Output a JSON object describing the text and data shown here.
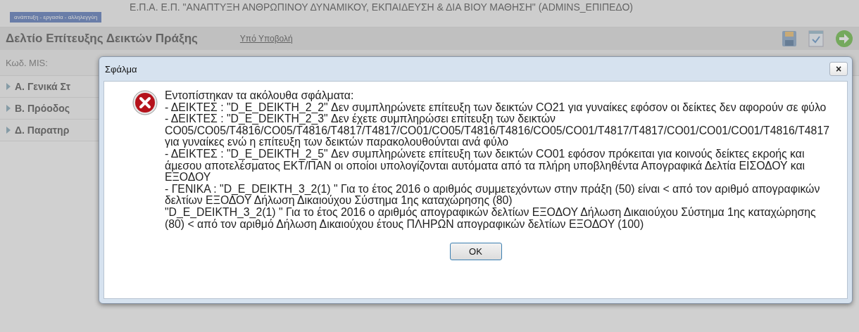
{
  "header": {
    "tagline": "ανάπτυξη - εργασία - αλληλεγγύη",
    "program_title": "Ε.Π.Α. Ε.Π. \"ΑΝΑΠΤΥΞΗ ΑΝΘΡΩΠΙΝΟΥ ΔΥΝΑΜΙΚΟΥ, ΕΚΠΑΙΔΕΥΣΗ & ΔΙΑ ΒΙΟΥ ΜΑΘΗΣΗ\" (ADMINS_ΕΠΙΠΕΔΟ)"
  },
  "page": {
    "title": "Δελτίο Επίτευξης Δεικτών Πράξης",
    "status_link": "Υπό Υποβολή",
    "mis_label": "Κωδ. MIS:",
    "sections": [
      {
        "label": "Α. Γενικά Στ",
        "expanded": false
      },
      {
        "label": "Β. Πρόοδος",
        "expanded": false
      },
      {
        "label": "Δ. Παρατηρ",
        "expanded": false
      }
    ]
  },
  "dialog": {
    "title": "Σφάλμα",
    "close_glyph": "×",
    "kind": "error",
    "message_lines": [
      "Εντοπίστηκαν τα ακόλουθα σφάλματα:",
      "- ΔΕΙΚΤΕΣ : \"D_E_DEIKTH_2_2\" Δεν συμπληρώνετε επίτευξη των δεικτών CO21 για γυναίκες εφόσον οι δείκτες δεν αφορούν σε φύλο",
      "- ΔΕΙΚΤΕΣ : \"D_E_DEIKTH_2_3\" Δεν έχετε συμπληρώσει επίτευξη των δεικτών",
      "CO05/CO05/T4816/CO05/T4816/T4817/T4817/CO01/CO05/T4816/T4816/CO05/CO01/T4817/T4817/CO01/CO01/CO01/T4816/T4817",
      "για γυναίκες ενώ η επίτευξη των δεικτών παρακολουθούνται ανά φύλο",
      "- ΔΕΙΚΤΕΣ : \"D_E_DEIKTH_2_5\" Δεν συμπληρώνετε επίτευξη των δεικτών CO01 εφόσον πρόκειται για κοινούς δείκτες εκροής και",
      "άμεσου αποτελέσματος ΕΚΤ/ΠΑΝ οι οποίοι υπολογίζονται αυτόματα από τα πλήρη υποβληθέντα Απογραφικά Δελτία ΕΙΣΟΔΟΥ και",
      "ΕΞΟΔΟΥ",
      "- ΓΕΝΙΚΑ : \"D_E_DEIKTH_3_2(1) \" Για το έτος 2016 ο αριθμός συμμετεχόντων στην πράξη (50) είναι < από τον αριθμό απογραφικών",
      "δελτίων ΕΞΟΔΟΥ Δήλωση Δικαιούχου Σύστημα 1ης καταχώρησης (80)",
      "\"D_E_DEIKTH_3_2(1) \" Για το έτος 2016 ο αριθμός απογραφικών δελτίων ΕΞΟΔΟΥ Δήλωση Δικαιούχου Σύστημα 1ης καταχώρησης",
      "(80) < από τον αριθμό Δήλωση Δικαιούχου έτους ΠΛΗΡΩΝ απογραφικών δελτίων ΕΞΟΔΟΥ (100)"
    ],
    "buttons": [
      "OK"
    ]
  }
}
